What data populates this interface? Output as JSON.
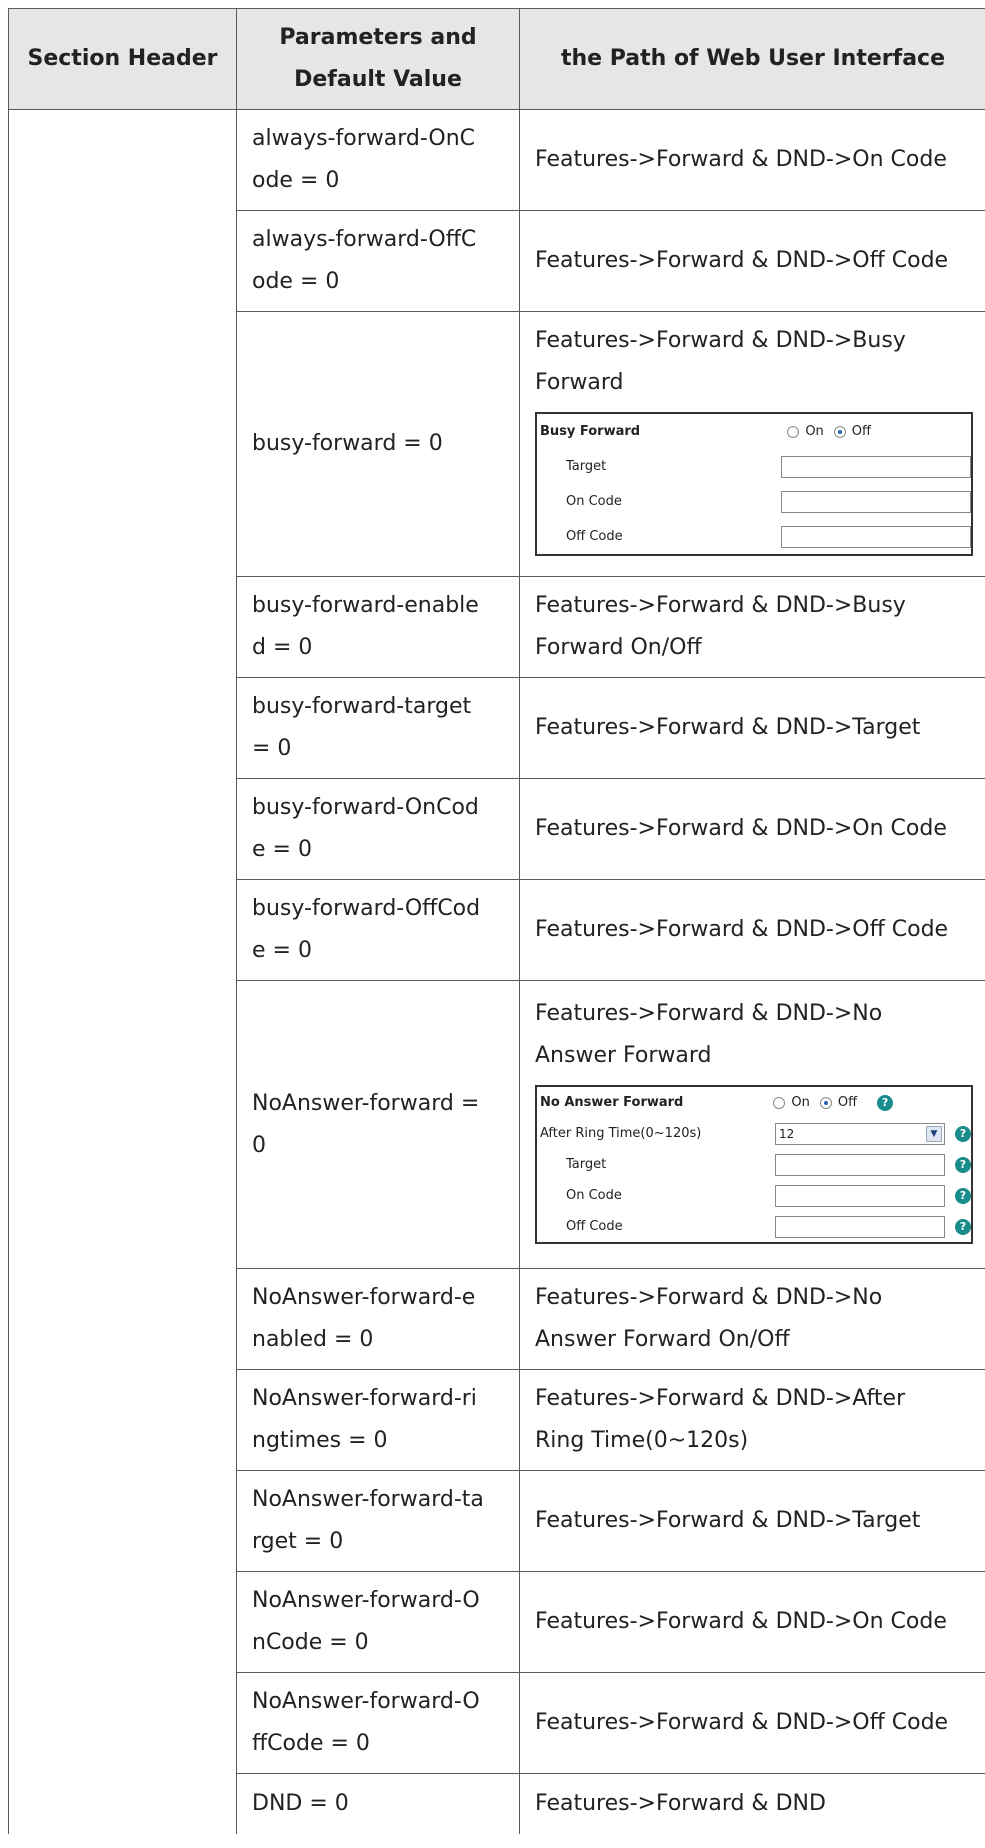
{
  "header": {
    "col1": "Section Header",
    "col2_line1": "Parameters and",
    "col2_line2": "Default Value",
    "col3": "the Path of Web User Interface"
  },
  "rows": [
    {
      "param": [
        "always-forward-OnC",
        "ode = 0"
      ],
      "path": [
        "Features->Forward & DND->On Code"
      ]
    },
    {
      "param": [
        "always-forward-OffC",
        "ode = 0"
      ],
      "path": [
        "Features->Forward & DND->Off Code"
      ]
    },
    {
      "param": [
        "busy-forward = 0"
      ],
      "path": [
        "Features->Forward & DND->Busy",
        "Forward"
      ]
    },
    {
      "param": [
        "busy-forward-enable",
        "d = 0"
      ],
      "path": [
        "Features->Forward & DND->Busy",
        "Forward On/Off"
      ]
    },
    {
      "param": [
        "busy-forward-target",
        "= 0"
      ],
      "path": [
        "Features->Forward & DND->Target"
      ]
    },
    {
      "param": [
        "busy-forward-OnCod",
        "e = 0"
      ],
      "path": [
        "Features->Forward & DND->On Code"
      ]
    },
    {
      "param": [
        "busy-forward-OffCod",
        "e = 0"
      ],
      "path": [
        "Features->Forward & DND->Off Code"
      ]
    },
    {
      "param": [
        "NoAnswer-forward =",
        "0"
      ],
      "path": [
        "Features->Forward & DND->No",
        "Answer Forward"
      ]
    },
    {
      "param": [
        "NoAnswer-forward-e",
        "nabled = 0"
      ],
      "path": [
        "Features->Forward & DND->No",
        "Answer Forward On/Off"
      ]
    },
    {
      "param": [
        "NoAnswer-forward-ri",
        "ngtimes = 0"
      ],
      "path": [
        "Features->Forward & DND->After",
        "Ring Time(0~120s)"
      ]
    },
    {
      "param": [
        "NoAnswer-forward-ta",
        "rget = 0"
      ],
      "path": [
        "Features->Forward & DND->Target"
      ]
    },
    {
      "param": [
        "NoAnswer-forward-O",
        "nCode = 0"
      ],
      "path": [
        "Features->Forward & DND->On Code"
      ]
    },
    {
      "param": [
        "NoAnswer-forward-O",
        "ffCode = 0"
      ],
      "path": [
        "Features->Forward & DND->Off Code"
      ]
    },
    {
      "param": [
        "DND = 0"
      ],
      "path": [
        "Features->Forward & DND"
      ]
    }
  ],
  "busy_panel": {
    "title": "Busy Forward",
    "on": "On",
    "off": "Off",
    "target": "Target",
    "on_code": "On Code",
    "off_code": "Off Code"
  },
  "noanswer_panel": {
    "title": "No Answer Forward",
    "on": "On",
    "off": "Off",
    "ring_time": "After Ring Time(0~120s)",
    "ring_value": "12",
    "target": "Target",
    "on_code": "On Code",
    "off_code": "Off Code",
    "help": "?"
  }
}
